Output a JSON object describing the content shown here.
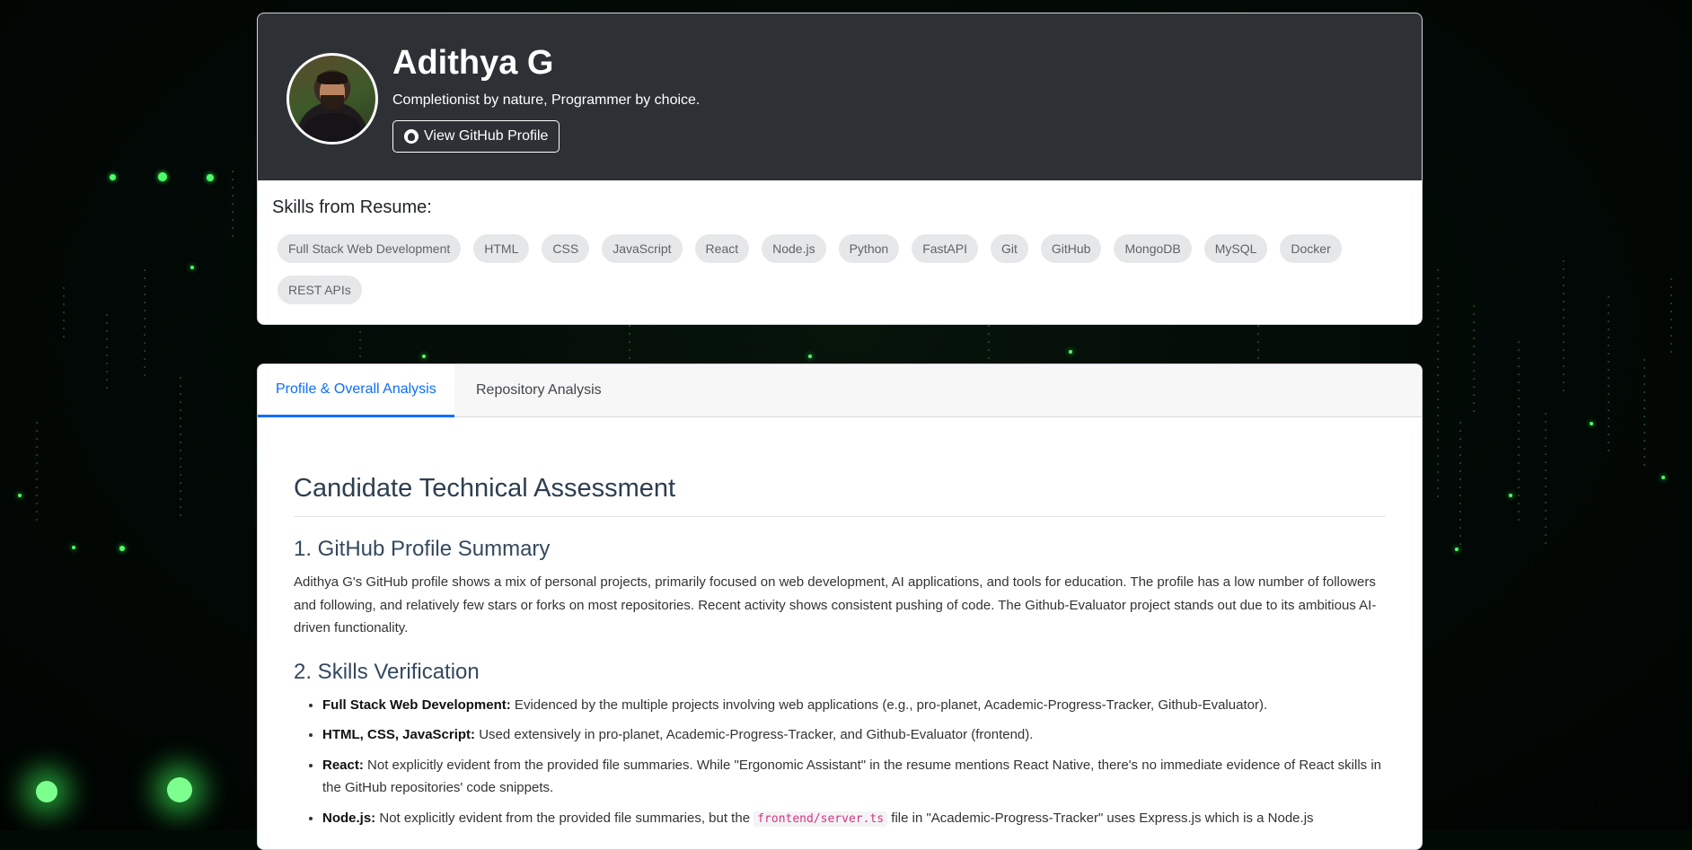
{
  "profile": {
    "name": "Adithya G",
    "tagline": "Completionist by nature, Programmer by choice.",
    "github_button": "View GitHub Profile"
  },
  "skills": {
    "title": "Skills from Resume:",
    "items": [
      "Full Stack Web Development",
      "HTML",
      "CSS",
      "JavaScript",
      "React",
      "Node.js",
      "Python",
      "FastAPI",
      "Git",
      "GitHub",
      "MongoDB",
      "MySQL",
      "Docker",
      "REST APIs"
    ]
  },
  "tabs": [
    {
      "label": "Profile & Overall Analysis"
    },
    {
      "label": "Repository Analysis"
    }
  ],
  "assessment": {
    "title": "Candidate Technical Assessment",
    "sections": [
      {
        "heading": "1. GitHub Profile Summary",
        "body": "Adithya G's GitHub profile shows a mix of personal projects, primarily focused on web development, AI applications, and tools for education. The profile has a low number of followers and following, and relatively few stars or forks on most repositories. Recent activity shows consistent pushing of code. The Github-Evaluator project stands out due to its ambitious AI-driven functionality."
      },
      {
        "heading": "2. Skills Verification",
        "items": [
          {
            "term": "Full Stack Web Development:",
            "text": " Evidenced by the multiple projects involving web applications (e.g., pro-planet, Academic-Progress-Tracker, Github-Evaluator)."
          },
          {
            "term": "HTML, CSS, JavaScript:",
            "text": " Used extensively in pro-planet, Academic-Progress-Tracker, and Github-Evaluator (frontend)."
          },
          {
            "term": "React:",
            "text": " Not explicitly evident from the provided file summaries. While \"Ergonomic Assistant\" in the resume mentions React Native, there's no immediate evidence of React skills in the GitHub repositories' code snippets."
          },
          {
            "term": "Node.js:",
            "text": " Not explicitly evident from the provided file summaries, but the ",
            "code": "frontend/server.ts",
            "text2": " file in \"Academic-Progress-Tracker\" uses Express.js which is a Node.js"
          }
        ]
      }
    ]
  }
}
